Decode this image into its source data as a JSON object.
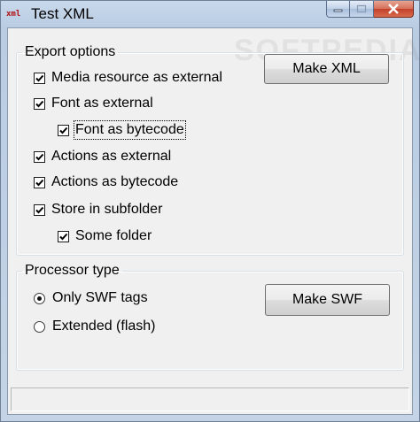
{
  "window": {
    "title": "Test XML",
    "app_icon_text": "xml"
  },
  "export_options": {
    "legend": "Export options",
    "make_button": "Make XML",
    "items": [
      {
        "label": "Media resource as external",
        "checked": true
      },
      {
        "label": "Font as external",
        "checked": true
      },
      {
        "label": "Font as bytecode",
        "checked": true
      },
      {
        "label": "Actions as external",
        "checked": true
      },
      {
        "label": "Actions as bytecode",
        "checked": true
      },
      {
        "label": "Store in subfolder",
        "checked": true
      },
      {
        "label": "Some folder",
        "checked": true
      }
    ]
  },
  "processor_type": {
    "legend": "Processor type",
    "make_button": "Make SWF",
    "options": [
      {
        "label": "Only SWF tags",
        "selected": true
      },
      {
        "label": "Extended (flash)",
        "selected": false
      }
    ]
  },
  "status_bar": {
    "text": ""
  },
  "watermark": {
    "text": "SOFTPEDIA"
  }
}
